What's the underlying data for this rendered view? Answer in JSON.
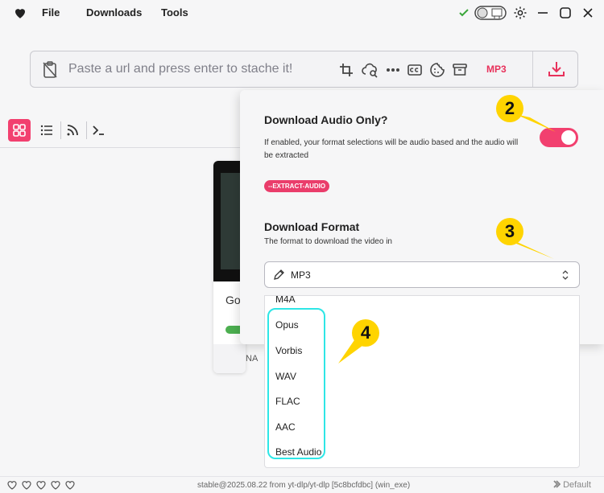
{
  "menu": {
    "file": "File",
    "downloads": "Downloads",
    "tools": "Tools"
  },
  "window": {
    "icons": [
      "heart-icon",
      "checkmark-icon",
      "theme-toggle-icon",
      "settings-icon",
      "minimize-icon",
      "maximize-icon",
      "close-icon"
    ]
  },
  "url_bar": {
    "placeholder": "Paste a url and press enter to stache it!",
    "format_label": "MP3",
    "tools": [
      "crop-icon",
      "cloud-search-icon",
      "more-icon",
      "captions-icon",
      "cookie-icon",
      "archive-icon"
    ]
  },
  "view_modes": [
    "grid",
    "list",
    "rss",
    "terminal"
  ],
  "card": {
    "title": "Go",
    "footer": "NA"
  },
  "panel": {
    "audio_only": {
      "title": "Download Audio Only?",
      "description": "If enabled, your format selections will be audio based and the audio will be extracted",
      "flag": "--EXTRACT-AUDIO",
      "enabled": true
    },
    "format": {
      "title": "Download Format",
      "description": "The format to download the video in",
      "selected": "MP3"
    }
  },
  "dropdown": {
    "options": [
      "M4A",
      "Opus",
      "Vorbis",
      "WAV",
      "FLAC",
      "AAC",
      "Best Audio"
    ]
  },
  "callouts": {
    "c2": "2",
    "c3": "3",
    "c4": "4"
  },
  "status": {
    "version": "stable@2025.08.22 from yt-dlp/yt-dlp [5c8bcfdbc] (win_exe)",
    "profile": "Default"
  },
  "colors": {
    "accent": "#f2406f",
    "highlight": "#2ee6e6",
    "callout": "#ffd400"
  }
}
